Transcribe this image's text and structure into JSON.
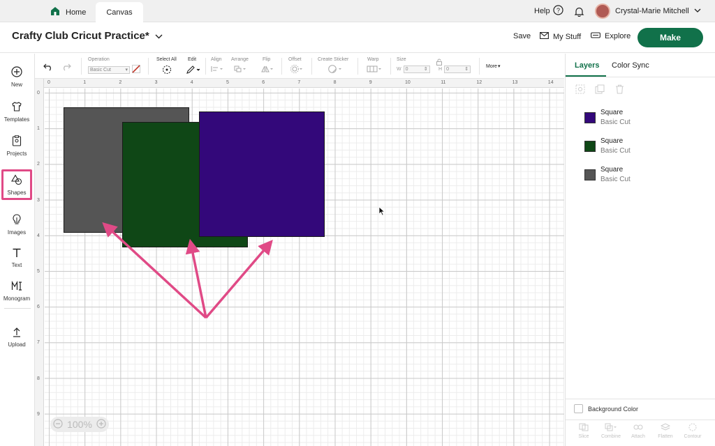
{
  "tabs": {
    "home": "Home",
    "canvas": "Canvas"
  },
  "header": {
    "help": "Help",
    "user": "Crystal-Marie Mitchell"
  },
  "project": {
    "title": "Crafty Club Cricut Practice*",
    "save": "Save",
    "my_stuff": "My Stuff",
    "explore": "Explore",
    "make": "Make"
  },
  "sidebar": {
    "new": "New",
    "templates": "Templates",
    "projects": "Projects",
    "shapes": "Shapes",
    "images": "Images",
    "text": "Text",
    "monogram": "Monogram",
    "upload": "Upload"
  },
  "toolbar": {
    "operation_label": "Operation",
    "operation_value": "Basic Cut",
    "select_all": "Select All",
    "edit": "Edit",
    "align": "Align",
    "arrange": "Arrange",
    "flip": "Flip",
    "offset": "Offset",
    "create_sticker": "Create Sticker",
    "warp": "Warp",
    "size": "Size",
    "w_label": "W",
    "w_value": "0",
    "h_label": "H",
    "h_value": "0",
    "more": "More"
  },
  "ruler": {
    "top": [
      "0",
      "1",
      "2",
      "3",
      "4",
      "5",
      "6",
      "7",
      "8",
      "9",
      "10",
      "11",
      "12",
      "13",
      "14"
    ],
    "left": [
      "0",
      "1",
      "2",
      "3",
      "4",
      "5",
      "6",
      "7",
      "8",
      "9"
    ]
  },
  "zoom": {
    "value": "100%",
    "minus": "−",
    "plus": "+"
  },
  "panel": {
    "tab_layers": "Layers",
    "tab_color_sync": "Color Sync",
    "layers": [
      {
        "name": "Square",
        "op": "Basic Cut",
        "color": "#33087a"
      },
      {
        "name": "Square",
        "op": "Basic Cut",
        "color": "#0f4716"
      },
      {
        "name": "Square",
        "op": "Basic Cut",
        "color": "#555555"
      }
    ],
    "background_color": "Background Color",
    "bottom_actions": [
      "Slice",
      "Combine",
      "Attach",
      "Flatten",
      "Contour"
    ]
  },
  "colors": {
    "accent": "#11714a",
    "highlight": "#e04a86"
  }
}
